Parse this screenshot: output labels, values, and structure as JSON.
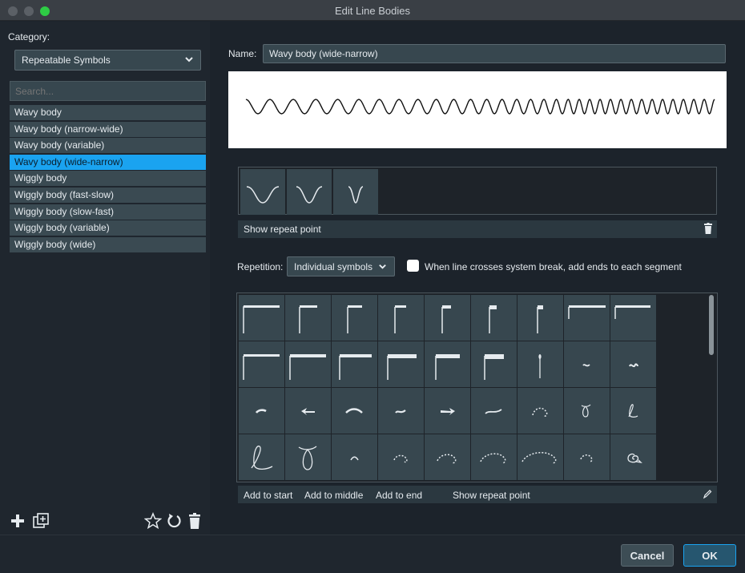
{
  "window": {
    "title": "Edit Line Bodies"
  },
  "sidebar": {
    "category_label": "Category:",
    "category_value": "Repeatable Symbols",
    "search_placeholder": "Search...",
    "items": [
      {
        "label": "Wavy body",
        "selected": false
      },
      {
        "label": "Wavy body (narrow-wide)",
        "selected": false
      },
      {
        "label": "Wavy body (variable)",
        "selected": false
      },
      {
        "label": "Wavy body (wide-narrow)",
        "selected": true
      },
      {
        "label": "Wiggly body",
        "selected": false
      },
      {
        "label": "Wiggly body (fast-slow)",
        "selected": false
      },
      {
        "label": "Wiggly body (slow-fast)",
        "selected": false
      },
      {
        "label": "Wiggly body (variable)",
        "selected": false
      },
      {
        "label": "Wiggly body (wide)",
        "selected": false
      }
    ],
    "bottom_icons": [
      "plus-icon",
      "duplicate-icon",
      "star-icon",
      "revert-icon",
      "delete-icon"
    ]
  },
  "editor": {
    "name_label": "Name:",
    "name_value": "Wavy body (wide-narrow)",
    "show_repeat_point_label": "Show repeat point",
    "repetition_label": "Repetition:",
    "repetition_value": "Individual symbols",
    "system_break_checkbox_label": "When line crosses system break, add ends to each segment",
    "system_break_checked": false,
    "grid_actions": {
      "add_to_start": "Add to start",
      "add_to_middle": "Add to middle",
      "add_to_end": "Add to end",
      "show_repeat_point": "Show repeat point"
    }
  },
  "footer": {
    "cancel_label": "Cancel",
    "ok_label": "OK"
  },
  "colors": {
    "accent": "#1aa3f0",
    "panel": "#37474f",
    "background": "#1c232b"
  }
}
